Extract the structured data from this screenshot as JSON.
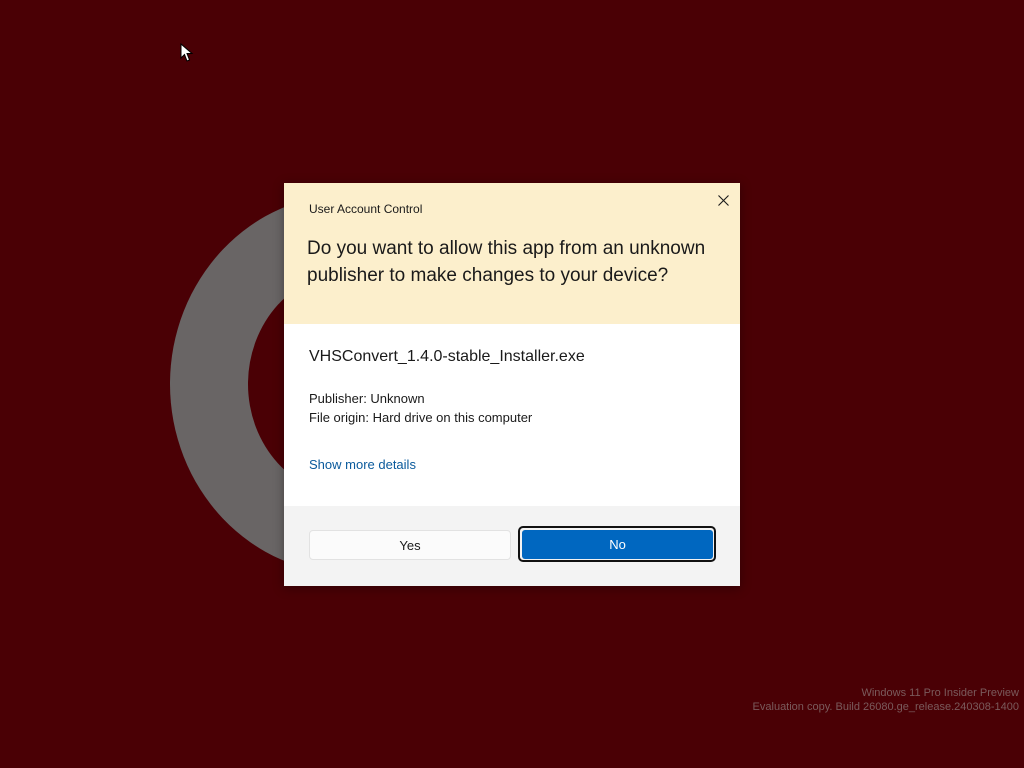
{
  "dialog": {
    "caption": "User Account Control",
    "question": "Do you want to allow this app from an unknown publisher to make changes to your device?",
    "app_name": "VHSConvert_1.4.0-stable_Installer.exe",
    "publisher": "Publisher: Unknown",
    "file_origin": "File origin: Hard drive on this computer",
    "details_link": "Show more details",
    "yes_label": "Yes",
    "no_label": "No"
  },
  "watermark": {
    "line1": "Windows 11 Pro Insider Preview",
    "line2": "Evaluation copy. Build 26080.ge_release.240308-1400"
  },
  "colors": {
    "desktop": "#4a0005",
    "header": "#fcefcc",
    "footer": "#f3f3f3",
    "accent": "#0067c0",
    "link": "#0a5a9c"
  },
  "icons": {
    "close": "close-icon",
    "cursor": "mouse-pointer-icon"
  }
}
